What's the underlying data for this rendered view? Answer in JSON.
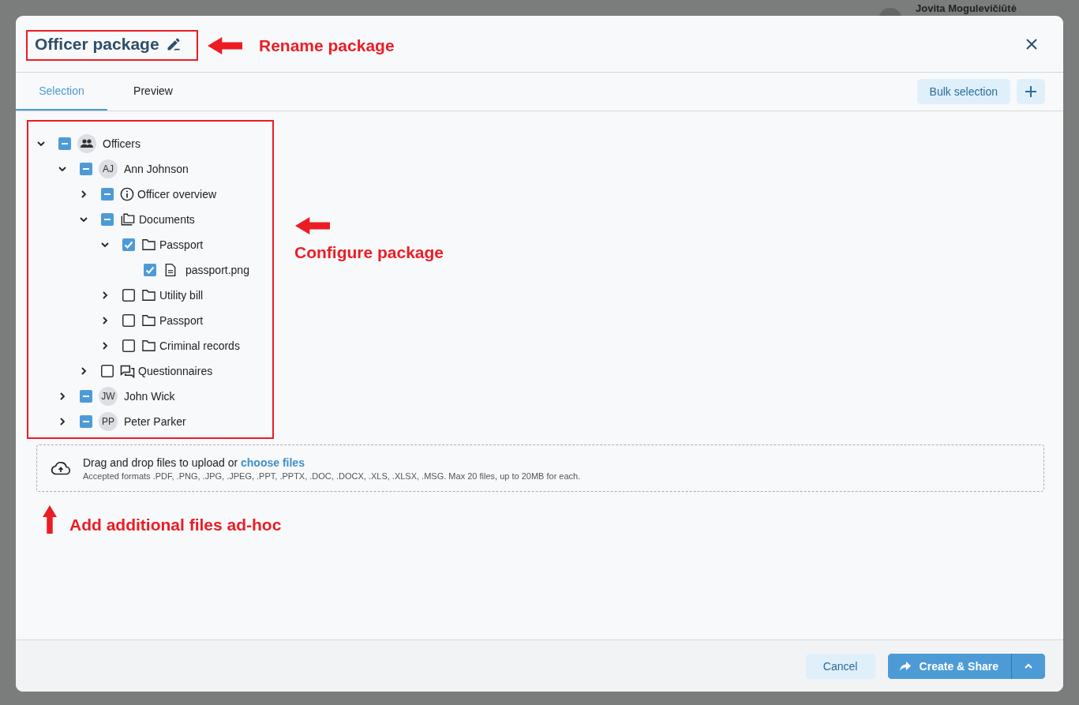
{
  "background": {
    "user_name": "Jovita Mogulevičiūtė"
  },
  "dialog": {
    "title": "Officer package",
    "tabs": [
      {
        "label": "Selection",
        "selected": true
      },
      {
        "label": "Preview",
        "selected": false
      }
    ],
    "toolbar": {
      "bulk_button": "Bulk selection"
    },
    "tree": [
      {
        "label": "Officers",
        "kind": "group",
        "checked": false,
        "indeterminate": true,
        "expanded": true,
        "children": [
          {
            "label": "Ann Johnson",
            "kind": "avatar",
            "initials": "AJ",
            "checked": false,
            "indeterminate": true,
            "expanded": true,
            "children": [
              {
                "label": "Officer overview",
                "kind": "info",
                "checked": false,
                "indeterminate": true,
                "expanded": false
              },
              {
                "label": "Documents",
                "kind": "documents",
                "checked": false,
                "indeterminate": true,
                "expanded": true,
                "children": [
                  {
                    "label": "Passport",
                    "kind": "folder",
                    "checked": true,
                    "indeterminate": false,
                    "expanded": true,
                    "children": [
                      {
                        "label": "passport.png",
                        "kind": "file",
                        "checked": true,
                        "indeterminate": false
                      }
                    ]
                  },
                  {
                    "label": "Utility bill",
                    "kind": "folder",
                    "checked": false,
                    "indeterminate": false,
                    "expanded": false
                  },
                  {
                    "label": "Passport",
                    "kind": "folder",
                    "checked": false,
                    "indeterminate": false,
                    "expanded": false
                  },
                  {
                    "label": "Criminal records",
                    "kind": "folder",
                    "checked": false,
                    "indeterminate": false,
                    "expanded": false
                  }
                ]
              },
              {
                "label": "Questionnaires",
                "kind": "chat",
                "checked": false,
                "indeterminate": false,
                "expanded": false
              }
            ]
          },
          {
            "label": "John Wick",
            "kind": "avatar",
            "initials": "JW",
            "checked": false,
            "indeterminate": true,
            "expanded": false
          },
          {
            "label": "Peter Parker",
            "kind": "avatar",
            "initials": "PP",
            "checked": false,
            "indeterminate": true,
            "expanded": false
          }
        ]
      }
    ],
    "upload": {
      "text": "Drag and drop files to upload or",
      "link": "choose files",
      "hint": "Accepted formats .PDF, .PNG, .JPG, .JPEG, .PPT, .PPTX, .DOC, .DOCX, .XLS, .XLSX, .MSG. Max 20 files, up to 20MB for each."
    },
    "footer": {
      "cancel": "Cancel",
      "primary": "Create & Share"
    }
  },
  "annotations": [
    {
      "label": "Rename package",
      "framed": true
    },
    {
      "label": "Configure package",
      "framed": true
    },
    {
      "label": "Add additional files ad-hoc",
      "framed": false
    }
  ]
}
